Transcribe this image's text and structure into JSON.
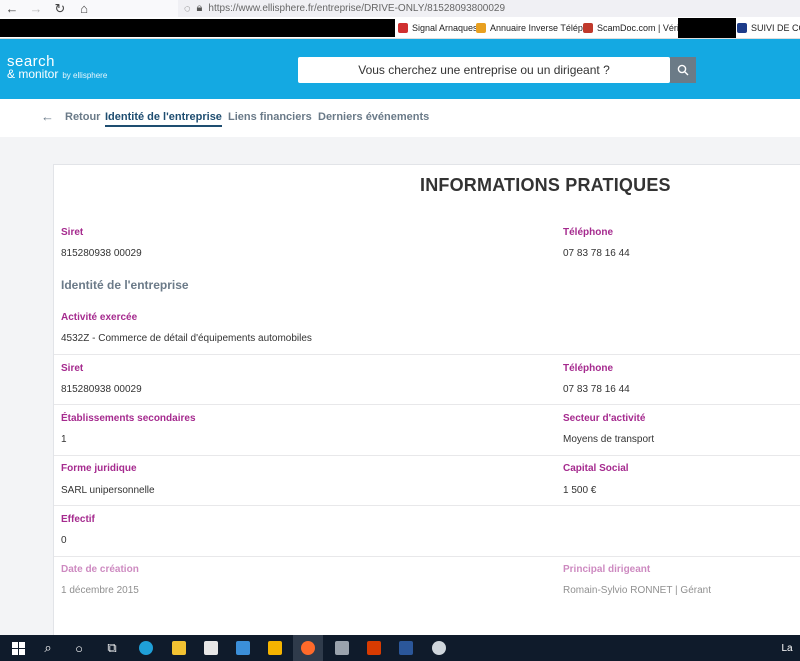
{
  "browser": {
    "url": "https://www.ellisphere.fr/entreprise/DRIVE-ONLY/81528093800029",
    "bookmarks": [
      {
        "label": "Signal Arnaques"
      },
      {
        "label": "Annuaire Inverse Télép..."
      },
      {
        "label": "ScamDoc.com | Vérifie..."
      },
      {
        "label": "SUIVI DE COLI"
      }
    ]
  },
  "header": {
    "logo_line1": "search",
    "logo_line2": "& monitor",
    "logo_by": "by ellisphere",
    "search_placeholder": "Vous cherchez une entreprise ou un dirigeant ?"
  },
  "subnav": {
    "back": "Retour",
    "tabs": [
      {
        "label": "Identité de l'entreprise",
        "active": true
      },
      {
        "label": "Liens financiers",
        "active": false
      },
      {
        "label": "Derniers événements",
        "active": false
      }
    ]
  },
  "card": {
    "title": "INFORMATIONS PRATIQUES",
    "top": {
      "siret_label": "Siret",
      "siret_value": "815280938 00029",
      "tel_label": "Téléphone",
      "tel_value": "07 83 78 16 44"
    },
    "section_heading": "Identité de l'entreprise",
    "activite_label": "Activité exercée",
    "activite_value": "4532Z - Commerce de détail d'équipements automobiles",
    "rows": {
      "siret_label": "Siret",
      "siret_value": "815280938 00029",
      "tel_label": "Téléphone",
      "tel_value": "07 83 78 16 44",
      "etab_label": "Établissements secondaires",
      "etab_value": "1",
      "secteur_label": "Secteur d'activité",
      "secteur_value": "Moyens de transport",
      "forme_label": "Forme juridique",
      "forme_value": "SARL unipersonnelle",
      "capital_label": "Capital Social",
      "capital_value": "1 500 €",
      "effectif_label": "Effectif",
      "effectif_value": "0",
      "creation_label": "Date de création",
      "creation_value": "1 décembre 2015",
      "dirigeant_label": "Principal dirigeant",
      "dirigeant_value": "Romain-Sylvio RONNET | Gérant"
    }
  },
  "taskbar": {
    "tray_text": "La"
  },
  "colors": {
    "header_blue": "#14a9e2",
    "label_magenta": "#a52a8e",
    "active_tab": "#1e4d70"
  }
}
